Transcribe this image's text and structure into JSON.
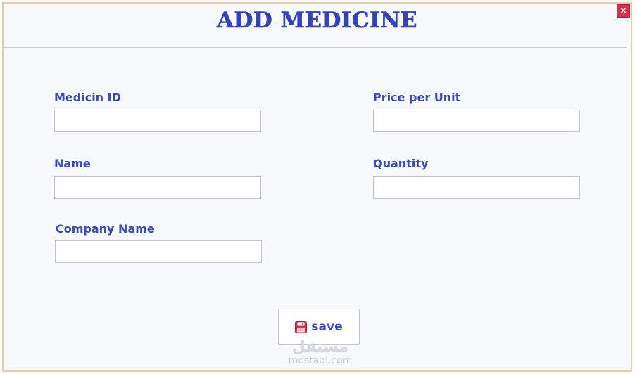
{
  "window": {
    "title": "ADD MEDICINE",
    "close_label": "×"
  },
  "form": {
    "medicine_id": {
      "label": "Medicin ID",
      "value": "",
      "placeholder": ""
    },
    "price_per_unit": {
      "label": "Price per Unit",
      "value": "",
      "placeholder": ""
    },
    "name": {
      "label": "Name",
      "value": "",
      "placeholder": ""
    },
    "quantity": {
      "label": "Quantity",
      "value": "",
      "placeholder": ""
    },
    "company_name": {
      "label": "Company Name",
      "value": "",
      "placeholder": ""
    }
  },
  "actions": {
    "save_label": "save",
    "save_icon": "floppy-disk-icon"
  },
  "watermark": {
    "arabic": "مستقل",
    "text": "mostaql.com"
  },
  "colors": {
    "accent": "#3a4ab6",
    "window_border": "#f5c890",
    "close_button": "#d8304a",
    "background": "#f7f8fa"
  }
}
